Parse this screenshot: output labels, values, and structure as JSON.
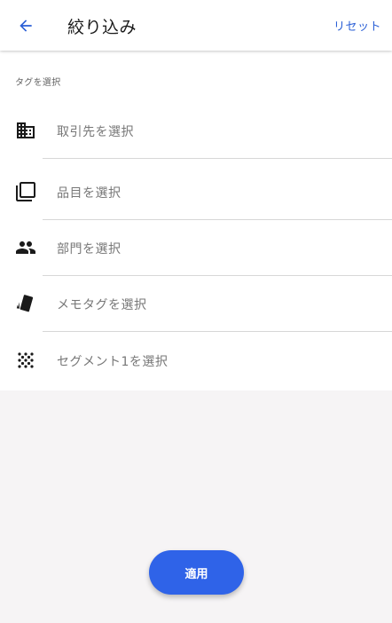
{
  "header": {
    "back_icon": "arrow-left-icon",
    "title": "絞り込み",
    "reset_label": "リセット"
  },
  "section": {
    "label": "タグを選択"
  },
  "filters": [
    {
      "icon": "building-icon",
      "label": "取引先を選択"
    },
    {
      "icon": "copy-icon",
      "label": "品目を選択"
    },
    {
      "icon": "people-icon",
      "label": "部門を選択"
    },
    {
      "icon": "sticky-note-icon",
      "label": "メモタグを選択"
    },
    {
      "icon": "dots-grid-icon",
      "label": "セグメント1を選択"
    }
  ],
  "footer": {
    "apply_label": "適用"
  },
  "colors": {
    "accent": "#2f63e8",
    "link": "#2a5fd6",
    "background": "#f6f4f5"
  }
}
